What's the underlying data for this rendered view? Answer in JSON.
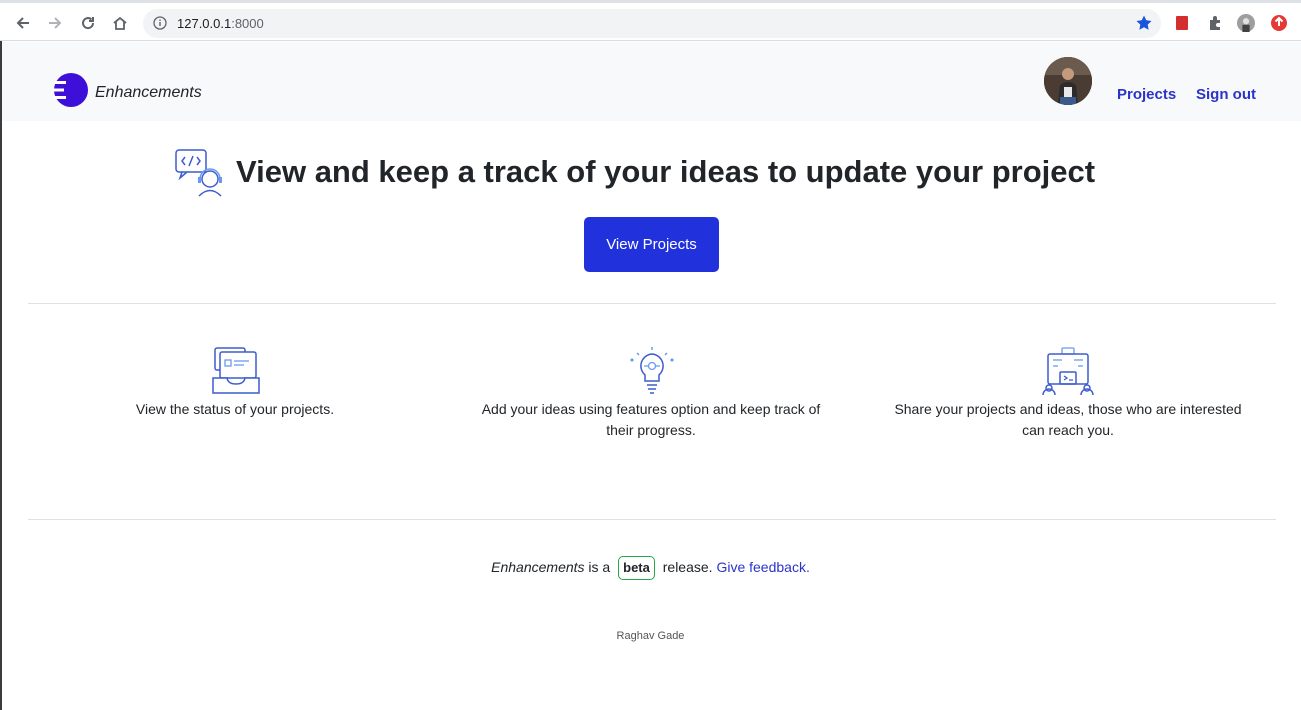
{
  "browser": {
    "url_host": "127.0.0.1",
    "url_port": ":8000"
  },
  "header": {
    "brand": "Enhancements",
    "nav": {
      "projects": "Projects",
      "sign_out": "Sign out"
    }
  },
  "hero": {
    "title": "View and keep a track of your ideas to update your project",
    "button": "View Projects"
  },
  "features": [
    {
      "line1": "View the status of your projects.",
      "line2": ""
    },
    {
      "line1": "Add your ideas using features option and keep track of",
      "line2": "their progress."
    },
    {
      "line1": "Share your projects and ideas, those who are interested",
      "line2": "can reach you."
    }
  ],
  "footer": {
    "brand": "Enhancements",
    "is_a": " is a ",
    "badge": "beta",
    "release": " release. ",
    "feedback": "Give feedback.",
    "author": "Raghav Gade"
  },
  "colors": {
    "primary": "#2132dd",
    "link": "#2a34c9",
    "logo": "#3d0fd8",
    "badge_border": "#28a745"
  }
}
